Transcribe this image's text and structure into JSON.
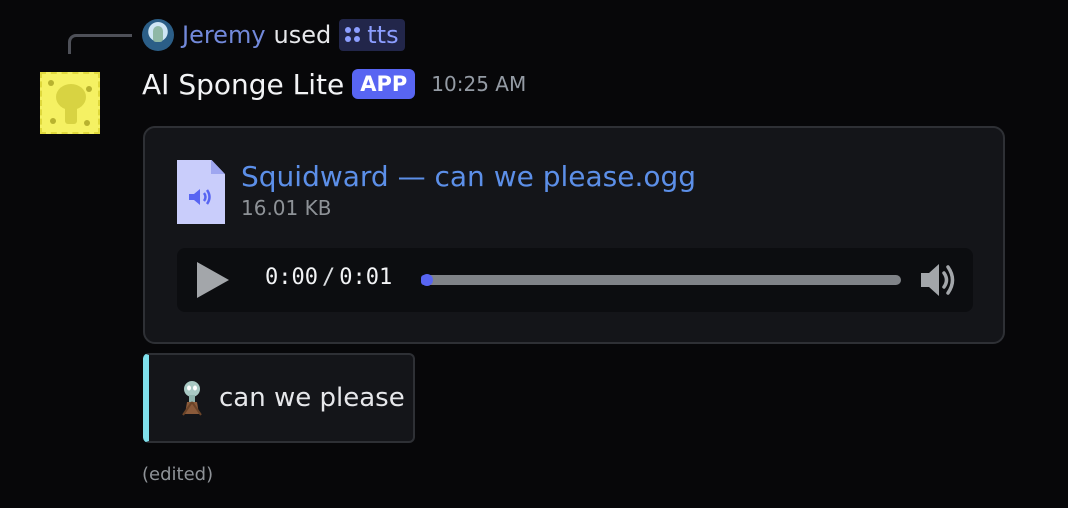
{
  "reply": {
    "user": "Jeremy",
    "action": "used",
    "command": "tts"
  },
  "message": {
    "author": "AI Sponge Lite",
    "badge": "APP",
    "timestamp": "10:25 AM",
    "edited_label": "(edited)"
  },
  "attachment": {
    "file_name": "Squidward — can we please.ogg",
    "file_size": "16.01 KB",
    "player": {
      "current_time": "0:00",
      "separator": "/",
      "duration": "0:01",
      "progress_fraction": 0.0
    }
  },
  "embed": {
    "text": "can we please",
    "accent_color": "#7fe0ec"
  },
  "colors": {
    "accent": "#5865f2",
    "link": "#5c8fe8",
    "background": "#070709"
  },
  "icons": {
    "command": "app-command-icon",
    "file": "audio-file-icon",
    "play": "play-icon",
    "volume": "volume-icon",
    "embed": "squidward-icon"
  }
}
